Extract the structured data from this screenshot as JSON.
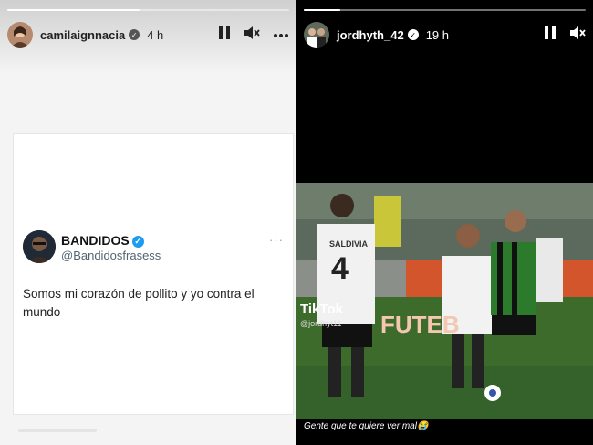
{
  "left_story": {
    "username": "camilaignnacia",
    "time": "4 h",
    "progress": 0.47,
    "controls": {
      "pause_icon": "pause-icon",
      "mute_icon": "muted-icon",
      "more_icon": "more-icon"
    },
    "tweet": {
      "display_name": "BANDIDOS",
      "handle": "@Bandidosfrasess",
      "text": "Somos mi corazón de pollito y yo contra el mundo",
      "more": "···"
    }
  },
  "right_story": {
    "username": "jordhyth_42",
    "time": "19 h",
    "progress": 0.13,
    "controls": {
      "pause_icon": "pause-icon",
      "mute_icon": "muted-icon"
    },
    "tiktok": {
      "logo": "TikTok",
      "handle": "@jordhyt11"
    },
    "photo": {
      "player_number": "4",
      "player_name": "SALDIVIA",
      "banner_text": "FUTEB"
    },
    "caption": "Gente que te quiere ver mal😭"
  },
  "colors": {
    "verified_badge": "#1d9bf0",
    "pitch": "#3d6b2b",
    "banner": "#d2552b"
  }
}
